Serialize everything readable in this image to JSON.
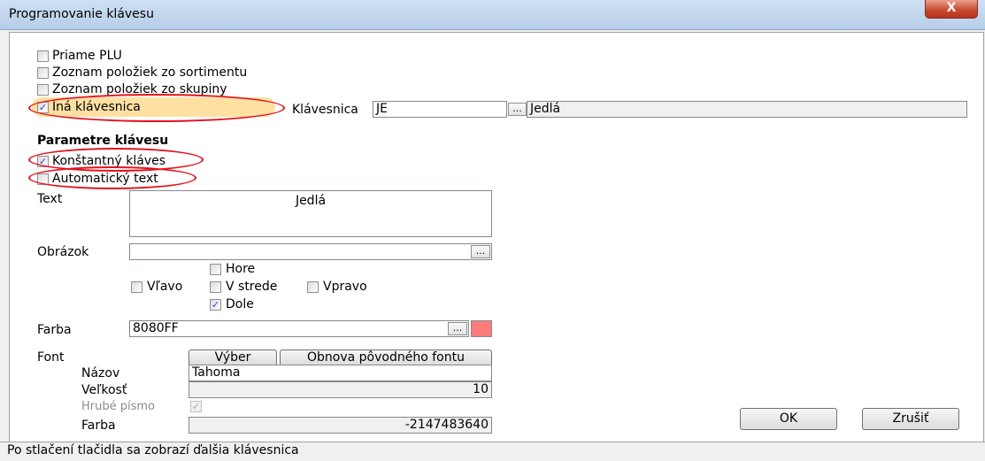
{
  "window": {
    "title": "Programovanie klávesu",
    "close_glyph": "X"
  },
  "options": [
    {
      "label": "Priame PLU",
      "checked": false
    },
    {
      "label": "Zoznam položiek zo sortimentu",
      "checked": false
    },
    {
      "label": "Zoznam položiek zo skupiny",
      "checked": false
    },
    {
      "label": "Iná klávesnica",
      "checked": true
    }
  ],
  "keyboard": {
    "label": "Klávesnica",
    "code": "JE",
    "browse": "...",
    "name": "Jedlá"
  },
  "params": {
    "heading": "Parametre klávesu",
    "constant": {
      "label": "Konštantný kláves",
      "checked": true
    },
    "auto_text": {
      "label": "Automatický text",
      "checked": false
    }
  },
  "text": {
    "label": "Text",
    "value": "Jedlá"
  },
  "image": {
    "label": "Obrázok",
    "value": "",
    "browse": "...",
    "positions": {
      "top": {
        "label": "Hore",
        "checked": false
      },
      "left": {
        "label": "Vľavo",
        "checked": false
      },
      "center": {
        "label": "V strede",
        "checked": false
      },
      "right": {
        "label": "Vpravo",
        "checked": false
      },
      "bottom": {
        "label": "Dole",
        "checked": true
      }
    }
  },
  "color": {
    "label": "Farba",
    "value": "8080FF",
    "browse": "...",
    "swatch": "#ff7c7c"
  },
  "font": {
    "label": "Font",
    "select_button": "Výber",
    "restore_button": "Obnova pôvodného fontu",
    "name_label": "Názov",
    "name_value": "Tahoma",
    "size_label": "Veľkosť",
    "size_value": "10",
    "bold_label": "Hrubé písmo",
    "bold_checked": true,
    "color_label": "Farba",
    "color_value": "-2147483640"
  },
  "buttons": {
    "ok": "OK",
    "cancel": "Zrušiť"
  },
  "status": "Po stlačení tlačidla sa zobrazí ďalšia klávesnica",
  "colors": {
    "highlight": "#ffe0a3",
    "annotation": "#e0141e",
    "titlebar": "#c3d6ee"
  }
}
